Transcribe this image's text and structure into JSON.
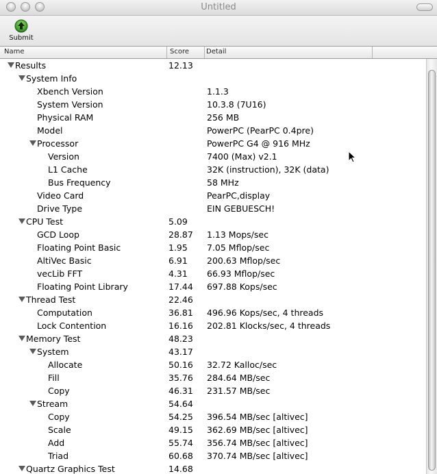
{
  "window": {
    "title": "Untitled"
  },
  "toolbar": {
    "submit_label": "Submit",
    "submit_icon": "up-arrow-icon"
  },
  "table": {
    "columns": {
      "name": "Name",
      "score": "Score",
      "detail": "Detail"
    },
    "rows": [
      {
        "name": "Results",
        "score": "12.13",
        "detail": "",
        "level": 0,
        "expandable": true
      },
      {
        "name": "System Info",
        "score": "",
        "detail": "",
        "level": 1,
        "expandable": true
      },
      {
        "name": "Xbench Version",
        "score": "",
        "detail": "1.1.3",
        "level": 2,
        "expandable": false
      },
      {
        "name": "System Version",
        "score": "",
        "detail": "10.3.8 (7U16)",
        "level": 2,
        "expandable": false
      },
      {
        "name": "Physical RAM",
        "score": "",
        "detail": "256 MB",
        "level": 2,
        "expandable": false
      },
      {
        "name": "Model",
        "score": "",
        "detail": "PowerPC (PearPC 0.4pre)",
        "level": 2,
        "expandable": false
      },
      {
        "name": "Processor",
        "score": "",
        "detail": "PowerPC G4 @ 916 MHz",
        "level": 2,
        "expandable": true
      },
      {
        "name": "Version",
        "score": "",
        "detail": "7400 (Max) v2.1",
        "level": 3,
        "expandable": false
      },
      {
        "name": "L1 Cache",
        "score": "",
        "detail": "32K (instruction), 32K (data)",
        "level": 3,
        "expandable": false
      },
      {
        "name": "Bus Frequency",
        "score": "",
        "detail": "58 MHz",
        "level": 3,
        "expandable": false
      },
      {
        "name": "Video Card",
        "score": "",
        "detail": "PearPC,display",
        "level": 2,
        "expandable": false
      },
      {
        "name": "Drive Type",
        "score": "",
        "detail": "EIN GEBUESCH!",
        "level": 2,
        "expandable": false
      },
      {
        "name": "CPU Test",
        "score": "5.09",
        "detail": "",
        "level": 1,
        "expandable": true
      },
      {
        "name": "GCD Loop",
        "score": "28.87",
        "detail": "1.13 Mops/sec",
        "level": 2,
        "expandable": false
      },
      {
        "name": "Floating Point Basic",
        "score": "1.95",
        "detail": "7.05 Mflop/sec",
        "level": 2,
        "expandable": false
      },
      {
        "name": "AltiVec Basic",
        "score": "6.91",
        "detail": "200.63 Mflop/sec",
        "level": 2,
        "expandable": false
      },
      {
        "name": "vecLib FFT",
        "score": "4.31",
        "detail": "66.93 Mflop/sec",
        "level": 2,
        "expandable": false
      },
      {
        "name": "Floating Point Library",
        "score": "17.44",
        "detail": "697.88 Kops/sec",
        "level": 2,
        "expandable": false
      },
      {
        "name": "Thread Test",
        "score": "22.46",
        "detail": "",
        "level": 1,
        "expandable": true
      },
      {
        "name": "Computation",
        "score": "36.81",
        "detail": "496.96 Kops/sec, 4 threads",
        "level": 2,
        "expandable": false
      },
      {
        "name": "Lock Contention",
        "score": "16.16",
        "detail": "202.81 Klocks/sec, 4 threads",
        "level": 2,
        "expandable": false
      },
      {
        "name": "Memory Test",
        "score": "48.23",
        "detail": "",
        "level": 1,
        "expandable": true
      },
      {
        "name": "System",
        "score": "43.17",
        "detail": "",
        "level": 2,
        "expandable": true
      },
      {
        "name": "Allocate",
        "score": "50.16",
        "detail": "32.72 Kalloc/sec",
        "level": 3,
        "expandable": false
      },
      {
        "name": "Fill",
        "score": "35.76",
        "detail": "284.64 MB/sec",
        "level": 3,
        "expandable": false
      },
      {
        "name": "Copy",
        "score": "46.31",
        "detail": "231.57 MB/sec",
        "level": 3,
        "expandable": false
      },
      {
        "name": "Stream",
        "score": "54.64",
        "detail": "",
        "level": 2,
        "expandable": true
      },
      {
        "name": "Copy",
        "score": "54.25",
        "detail": "396.54 MB/sec [altivec]",
        "level": 3,
        "expandable": false
      },
      {
        "name": "Scale",
        "score": "49.15",
        "detail": "362.69 MB/sec [altivec]",
        "level": 3,
        "expandable": false
      },
      {
        "name": "Add",
        "score": "55.74",
        "detail": "356.74 MB/sec [altivec]",
        "level": 3,
        "expandable": false
      },
      {
        "name": "Triad",
        "score": "60.68",
        "detail": "370.74 MB/sec [altivec]",
        "level": 3,
        "expandable": false
      },
      {
        "name": "Quartz Graphics Test",
        "score": "14.68",
        "detail": "",
        "level": 1,
        "expandable": true
      }
    ]
  }
}
